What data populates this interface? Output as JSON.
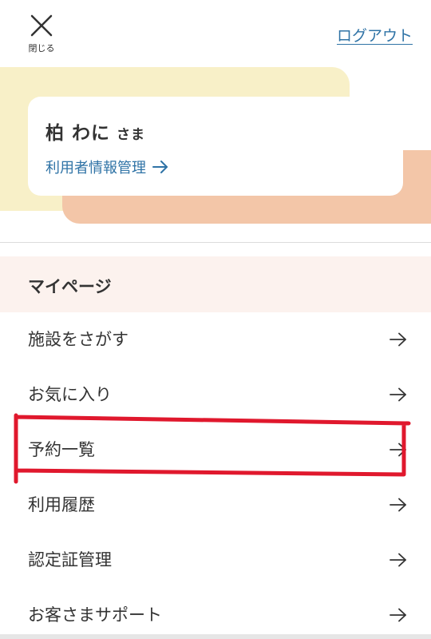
{
  "header": {
    "close_label": "閉じる",
    "logout_label": "ログアウト"
  },
  "user": {
    "name": "柏 わに",
    "suffix": "さま",
    "manage_label": "利用者情報管理"
  },
  "section": {
    "title": "マイページ"
  },
  "menu": {
    "items": [
      {
        "label": "施設をさがす"
      },
      {
        "label": "お気に入り"
      },
      {
        "label": "予約一覧"
      },
      {
        "label": "利用履歴"
      },
      {
        "label": "認定証管理"
      },
      {
        "label": "お客さまサポート"
      }
    ]
  },
  "colors": {
    "link": "#2f73a6",
    "card_yellow": "#f8f0c8",
    "card_orange": "#f3c6a8",
    "section_bg": "#fcf2ee",
    "annotation_red": "#e0182d"
  },
  "icons": {
    "close": "close-icon",
    "arrow": "arrow-right-icon"
  }
}
